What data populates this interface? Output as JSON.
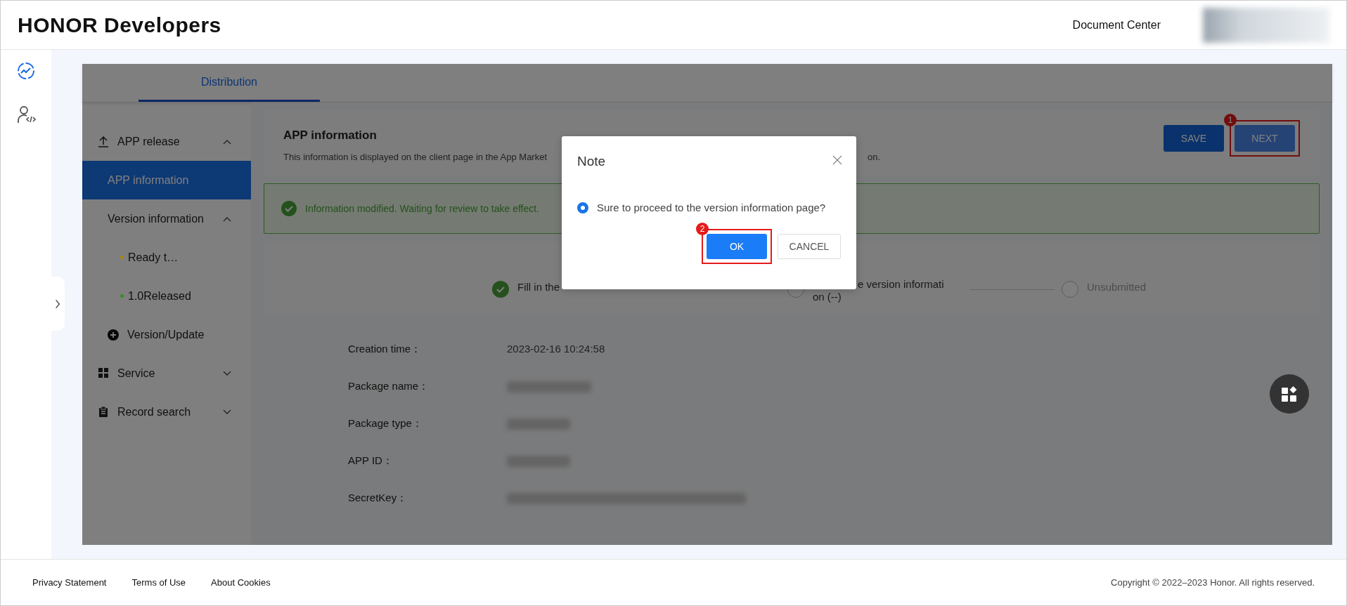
{
  "header": {
    "logo": "HONOR Developers",
    "links": [
      "Document Center"
    ]
  },
  "rail": [
    {
      "selected": true
    },
    {
      "selected": false
    }
  ],
  "tabs": [
    {
      "label": "Distribution",
      "selected": true
    }
  ],
  "side_menu": [
    {
      "kind": "group",
      "label": "APP release",
      "expanded": true,
      "children": [
        {
          "kind": "item",
          "label": "APP information",
          "selected": true
        },
        {
          "kind": "group",
          "label": "Version information",
          "expanded": true,
          "children": [
            {
              "kind": "version",
              "label": "Ready t…",
              "color": "#a8870f"
            },
            {
              "kind": "version",
              "label": "1.0Released",
              "color": "#3f8a2a"
            }
          ]
        },
        {
          "kind": "action",
          "label": "Version/Update"
        }
      ]
    },
    {
      "kind": "group",
      "label": "Service",
      "expanded": false
    },
    {
      "kind": "group",
      "label": "Record search",
      "expanded": false
    }
  ],
  "page_header": {
    "title": "APP information",
    "description_parts": [
      "This information is displayed on the client page in the App Market",
      "on."
    ],
    "buttons": [
      {
        "label": "SAVE",
        "kind": "primary"
      },
      {
        "label": "NEXT",
        "kind": "light",
        "callout": "1"
      }
    ]
  },
  "alert": {
    "text": "Information modified. Waiting for review to take effect."
  },
  "steps": [
    {
      "lines": [
        "Fill in the"
      ],
      "done": true
    },
    {
      "lines": [
        "e version informati",
        "on (--)"
      ],
      "done": false
    },
    {
      "lines": [
        "Unsubmitted"
      ],
      "done": false
    }
  ],
  "details": [
    {
      "label": "Creation time：",
      "kind": "text",
      "value": "2023-02-16 10:24:58"
    },
    {
      "label": "Package name：",
      "kind": "redacted"
    },
    {
      "label": "Package type：",
      "kind": "redacted"
    },
    {
      "label": "APP ID：",
      "kind": "redacted"
    },
    {
      "label": "SecretKey：",
      "kind": "redacted"
    }
  ],
  "dialog": {
    "title": "Note",
    "option": {
      "label": "Sure to proceed to the version information page?",
      "selected": true
    },
    "buttons": [
      {
        "label": "OK",
        "kind": "primary",
        "callout": "2"
      },
      {
        "label": "CANCEL",
        "kind": "default"
      }
    ]
  },
  "footer": {
    "links": [
      "Privacy Statement",
      "Terms of Use",
      "About Cookies"
    ],
    "copyright": "Copyright © 2022–2023 Honor. All rights reserved."
  }
}
